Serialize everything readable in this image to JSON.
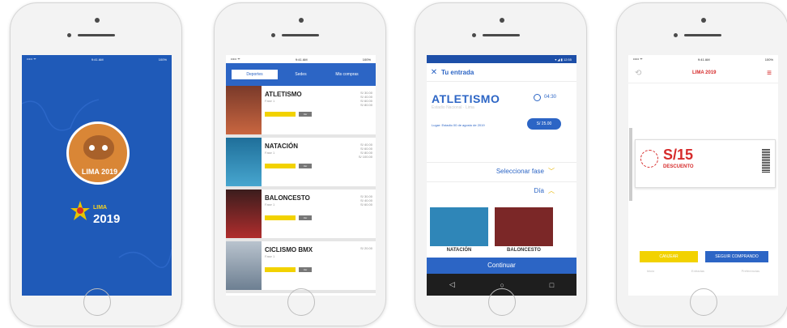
{
  "status": {
    "signal": "••••• ᯤ",
    "time": "9:41 AM",
    "time2": "9:41 AM",
    "battery": "100%",
    "android": "▾ ◢ ▮ 12:55"
  },
  "splash": {
    "badge_text": "LIMA\n2019",
    "logo_main": "2019",
    "logo_top": "LIMA"
  },
  "list": {
    "tabs": [
      {
        "label": "Deportes"
      },
      {
        "label": "Sedes"
      },
      {
        "label": "Mis compras"
      }
    ],
    "items": [
      {
        "name": "ATLETISMO",
        "sub": "Fase 1",
        "prices": "S/ 30.00\nS/ 40.00\nS/ 60.00\nS/ 80.00"
      },
      {
        "name": "NATACIÓN",
        "sub": "Fase 1",
        "prices": "S/ 40.00\nS/ 60.00\nS/ 80.00\nS/ 100.00"
      },
      {
        "name": "BALONCESTO",
        "sub": "Fase 1",
        "prices": "S/ 30.00\nS/ 40.00\nS/ 60.00"
      },
      {
        "name": "CICLISMO BMX",
        "sub": "Fase 1",
        "prices": "S/ 20.00"
      }
    ],
    "buy_label": "Ver"
  },
  "detail": {
    "header": "Tu entrada",
    "event": "ATLETISMO",
    "event_sub": "Estadio Nacional · Lima",
    "time": "04:30",
    "place": "Lugar: Estadio 00 de agosto de 2019",
    "price": "S/ 25.00",
    "accordion1": "Seleccionar fase",
    "accordion2": "Día",
    "sports": [
      {
        "label": "NATACIÓN"
      },
      {
        "label": "BALONCESTO"
      }
    ],
    "cta": "Continuar",
    "android_nav": [
      "◁",
      "○",
      "□"
    ]
  },
  "coupon": {
    "logo": "LIMA 2019",
    "amount": "S/15",
    "desc": "DESCUENTO",
    "circle_text": "Lima 2019",
    "btn_left": "CANJEAR",
    "btn_right": "SEGUIR COMPRANDO",
    "nav": [
      "Inicio",
      "Entradas",
      "Preferencias"
    ]
  }
}
